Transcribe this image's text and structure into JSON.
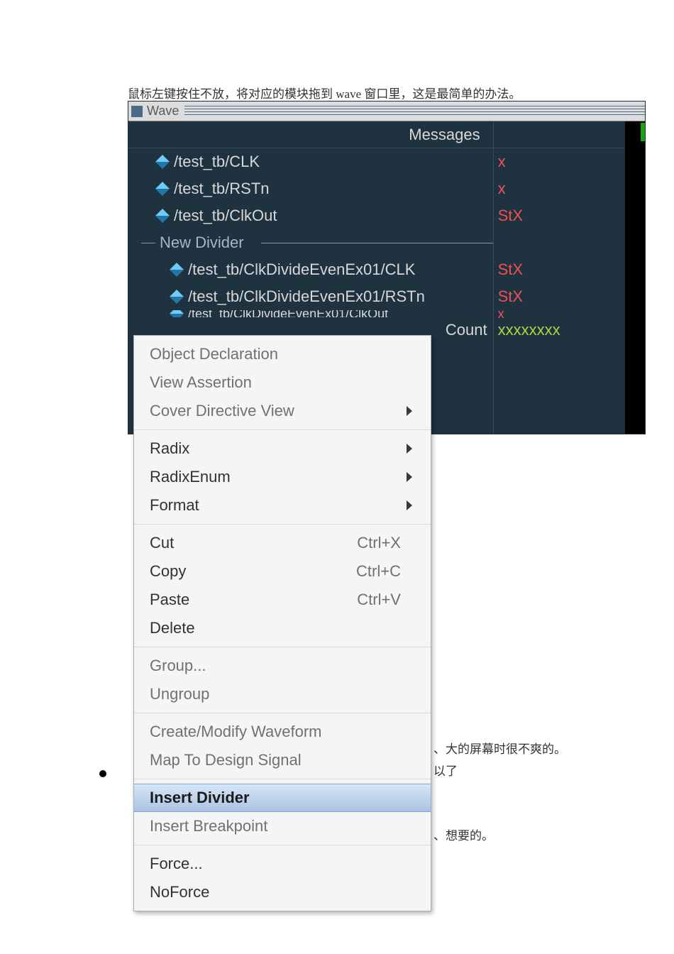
{
  "caption": "鼠标左键按住不放，将对应的模块拖到 wave 窗口里，这是最简单的办法。",
  "side_texts": {
    "t1": "、大的屏幕时很不爽的。",
    "t2": "以了",
    "t3": "、想要的。"
  },
  "wave": {
    "title": "Wave",
    "messages_header": "Messages",
    "signals": [
      {
        "name": "/test_tb/CLK",
        "value": "x",
        "value_color": "red",
        "indent": false
      },
      {
        "name": "/test_tb/RSTn",
        "value": "x",
        "value_color": "red",
        "indent": false
      },
      {
        "name": "/test_tb/ClkOut",
        "value": "StX",
        "value_color": "red",
        "indent": false
      },
      {
        "divider": "New Divider"
      },
      {
        "name": "/test_tb/ClkDivideEvenEx01/CLK",
        "value": "StX",
        "value_color": "red",
        "indent": true
      },
      {
        "name": "/test_tb/ClkDivideEvenEx01/RSTn",
        "value": "StX",
        "value_color": "red",
        "indent": true
      },
      {
        "partial_name": "/test_tb/ClkDivideEvenEx01/ClkOut",
        "value": "x",
        "value_color": "red",
        "indent": true
      },
      {
        "partial_name": "Count",
        "value": "xxxxxxxx",
        "value_color": "green",
        "indent": true
      }
    ]
  },
  "context_menu": {
    "groups": [
      [
        {
          "label": "Object Declaration"
        },
        {
          "label": "View Assertion"
        },
        {
          "label": "Cover Directive View",
          "submenu": true
        }
      ],
      [
        {
          "label": "Radix",
          "submenu": true,
          "dark": true
        },
        {
          "label": "RadixEnum",
          "submenu": true,
          "dark": true
        },
        {
          "label": "Format",
          "submenu": true,
          "dark": true
        }
      ],
      [
        {
          "label": "Cut",
          "shortcut": "Ctrl+X",
          "dark": true
        },
        {
          "label": "Copy",
          "shortcut": "Ctrl+C",
          "dark": true
        },
        {
          "label": "Paste",
          "shortcut": "Ctrl+V",
          "dark": true
        },
        {
          "label": "Delete",
          "dark": true
        }
      ],
      [
        {
          "label": "Group..."
        },
        {
          "label": "Ungroup"
        }
      ],
      [
        {
          "label": "Create/Modify Waveform"
        },
        {
          "label": "Map To Design Signal"
        }
      ],
      [
        {
          "label": "Insert Divider",
          "highlight": true
        },
        {
          "label": "Insert Breakpoint"
        }
      ],
      [
        {
          "label": "Force...",
          "dark": true
        },
        {
          "label": "NoForce",
          "dark": true
        }
      ]
    ]
  }
}
